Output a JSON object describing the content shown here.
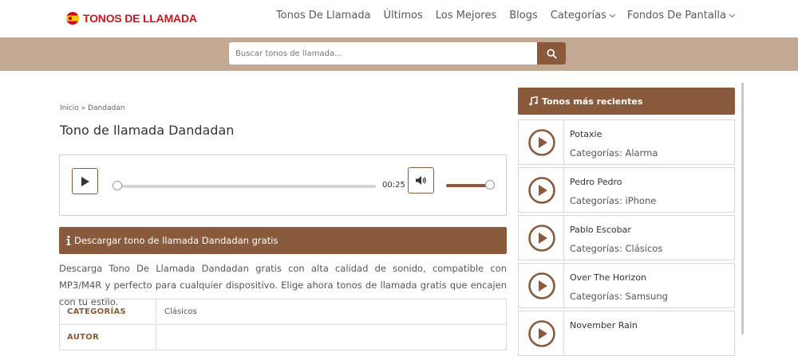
{
  "brand": {
    "name": "TONOS DE LLAMADA"
  },
  "nav": {
    "items": [
      {
        "label": "Tonos De Llamada"
      },
      {
        "label": "Últimos"
      },
      {
        "label": "Los Mejores"
      },
      {
        "label": "Blogs"
      },
      {
        "label": "Categorías"
      },
      {
        "label": "Fondos De Pantalla"
      }
    ]
  },
  "search": {
    "placeholder": "Buscar tonos de llamada..."
  },
  "breadcrumb": {
    "home": "Inicio",
    "separator": "»",
    "current": "Dandadan"
  },
  "page": {
    "title": "Tono de llamada Dandadan"
  },
  "player": {
    "time": "00:25",
    "progress": 0.0,
    "volume": 1.0
  },
  "download": {
    "header": "Descargar tono de llamada Dandadan gratis",
    "description": "Descarga Tono De Llamada Dandadan gratis con alta calidad de sonido, compatible con MP3/M4R y perfecto para cualquier dispositivo. Elige ahora tonos de llamada gratis que encajen con tu estilo."
  },
  "info_table": {
    "rows": [
      {
        "key": "CATEGORÍAS",
        "value": "Clásicos"
      },
      {
        "key": "AUTOR",
        "value": ""
      }
    ]
  },
  "sidebar": {
    "header": "Tonos más recientes",
    "category_prefix": "Categorías:",
    "items": [
      {
        "title": "Potaxie",
        "category": "Alarma"
      },
      {
        "title": "Pedro Pedro",
        "category": "iPhone"
      },
      {
        "title": "Pablo Escobar",
        "category": "Clásicos"
      },
      {
        "title": "Over The Horizon",
        "category": "Samsung"
      },
      {
        "title": "November Rain",
        "category": ""
      }
    ]
  },
  "colors": {
    "accent": "#8a5a3d",
    "band": "#c3a994",
    "brand_red": "#c0191f"
  },
  "icons": [
    "search-icon",
    "play-icon",
    "volume-icon",
    "info-icon",
    "music-note-icon",
    "chevron-down-icon"
  ]
}
